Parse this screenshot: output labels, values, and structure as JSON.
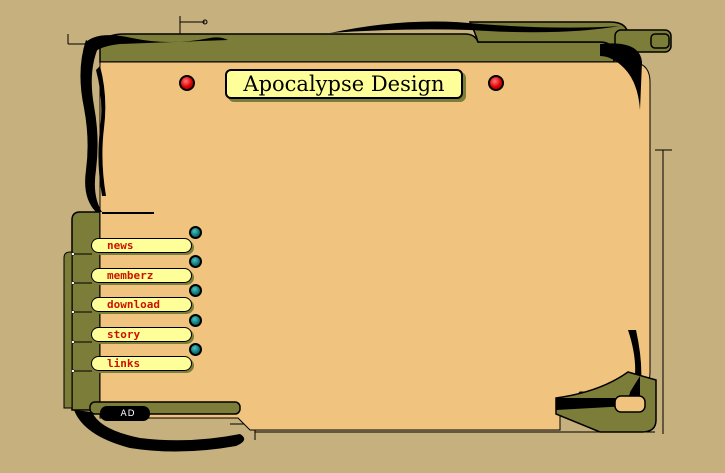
{
  "site": {
    "title": "Apocalypse Design",
    "logo_text": "AD"
  },
  "nav": {
    "items": [
      {
        "id": "news",
        "label": "news"
      },
      {
        "id": "memberz",
        "label": "memberz"
      },
      {
        "id": "download",
        "label": "download"
      },
      {
        "id": "story",
        "label": "story"
      },
      {
        "id": "links",
        "label": "links"
      }
    ]
  },
  "colors": {
    "background": "#c6b07d",
    "panel": "#f0c47e",
    "frame_olive": "#7d7d3a",
    "frame_black": "#000000",
    "plate_yellow": "#ffff99",
    "nav_text_red": "#cc1100",
    "indicator_red": "#e00000",
    "nav_dot_teal": "#0d7a7a"
  }
}
